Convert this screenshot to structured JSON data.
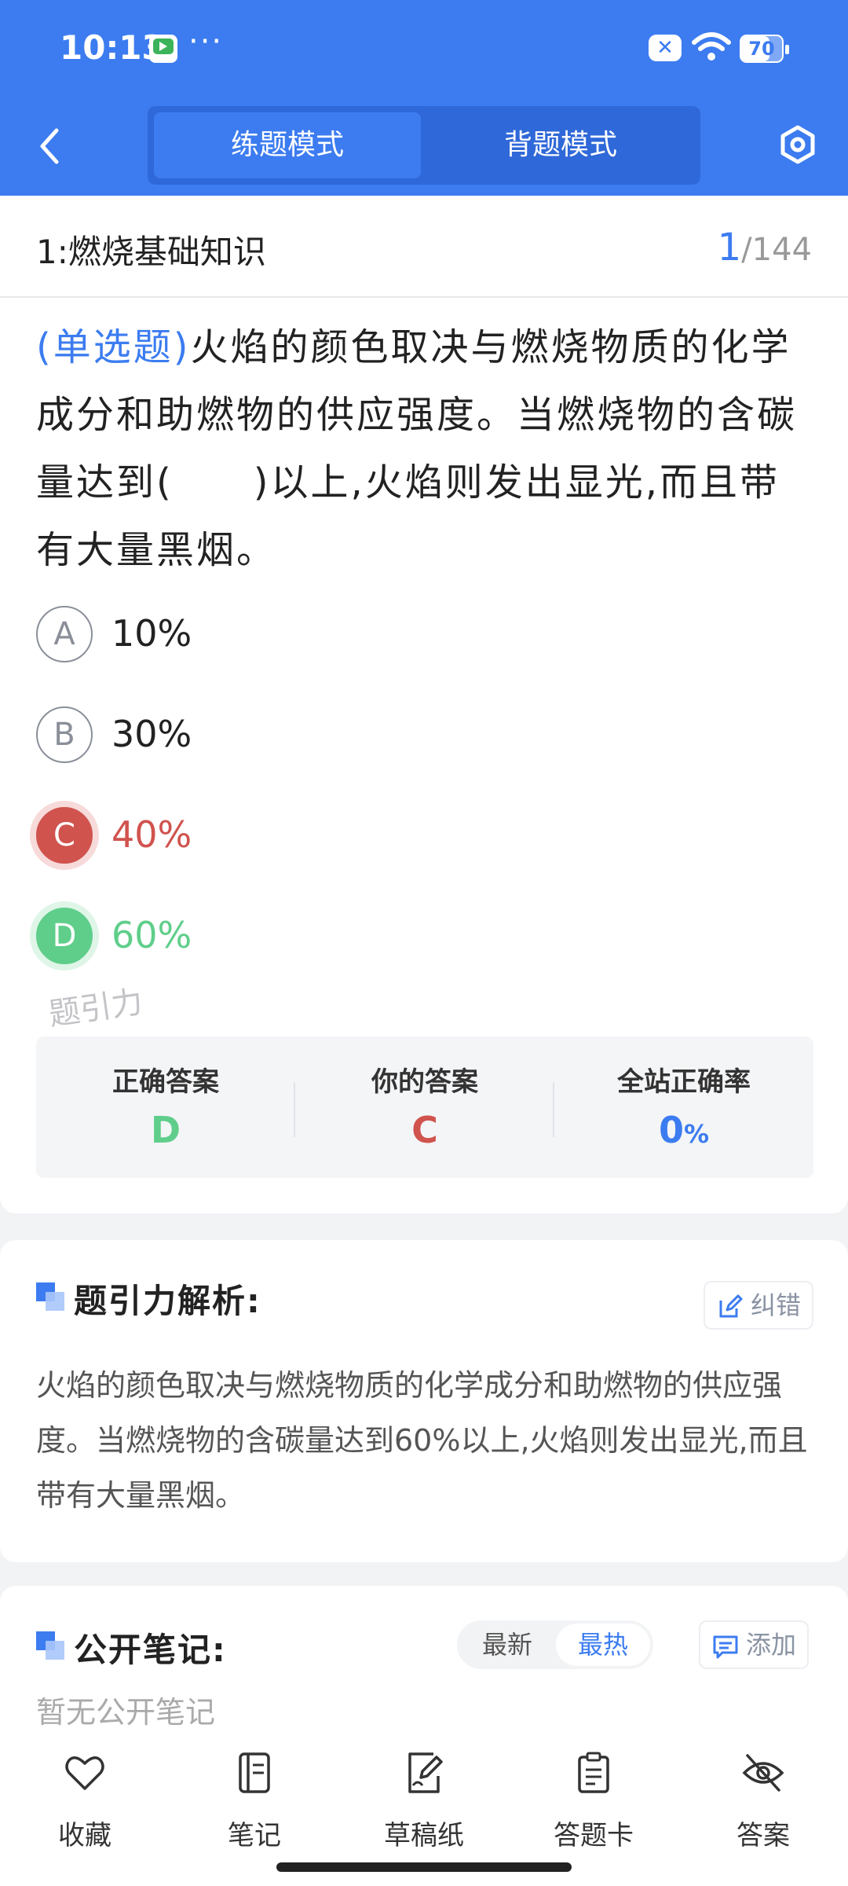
{
  "status_bar": {
    "time": "10:13",
    "dots": "···",
    "battery": "70",
    "battery_level": 0.7
  },
  "header": {
    "tabs": [
      "练题模式",
      "背题模式"
    ],
    "active_tab": 0
  },
  "question": {
    "section": "1:燃烧基础知识",
    "index": "1",
    "total": "/144",
    "type": "(单选题)",
    "text": "火焰的颜色取决与燃烧物质的化学成分和助燃物的供应强度。当燃烧物的含碳量达到(　　)以上,火焰则发出显光,而且带有大量黑烟。",
    "options": [
      {
        "letter": "A",
        "text": "10%",
        "state": "normal"
      },
      {
        "letter": "B",
        "text": "30%",
        "state": "normal"
      },
      {
        "letter": "C",
        "text": "40%",
        "state": "wrong"
      },
      {
        "letter": "D",
        "text": "60%",
        "state": "right"
      }
    ],
    "watermark": "题引力"
  },
  "result": {
    "correct_label": "正确答案",
    "correct_value": "D",
    "yours_label": "你的答案",
    "yours_value": "C",
    "rate_label": "全站正确率",
    "rate_value": "0",
    "rate_unit": "%"
  },
  "analysis": {
    "title": "题引力解析:",
    "report_label": "纠错",
    "text": "火焰的颜色取决与燃烧物质的化学成分和助燃物的供应强度。当燃烧物的含碳量达到60%以上,火焰则发出显光,而且带有大量黑烟。"
  },
  "notes": {
    "title": "公开笔记:",
    "sort_options": [
      "最新",
      "最热"
    ],
    "active_sort": 1,
    "add_label": "添加",
    "empty_text": "暂无公开笔记"
  },
  "bottom_bar": [
    {
      "label": "收藏",
      "icon": "heart-icon"
    },
    {
      "label": "笔记",
      "icon": "notebook-icon"
    },
    {
      "label": "草稿纸",
      "icon": "draft-paper-icon"
    },
    {
      "label": "答题卡",
      "icon": "answer-sheet-icon"
    },
    {
      "label": "答案",
      "icon": "eye-off-icon"
    }
  ],
  "colors": {
    "primary": "#3c7cf0",
    "wrong": "#d0534e",
    "right": "#5fce8a"
  }
}
